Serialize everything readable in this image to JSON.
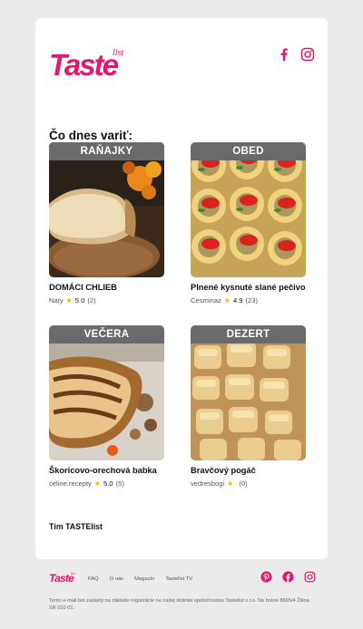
{
  "brand": {
    "logo_text": "Taste",
    "logo_suffix": "list",
    "accent_color": "#e2186f"
  },
  "header": {
    "social": [
      {
        "name": "facebook-icon"
      },
      {
        "name": "instagram-icon"
      }
    ]
  },
  "section": {
    "title": "Čo dnes variť:"
  },
  "recipes": [
    {
      "category": "RAŇAJKY",
      "title": "DOMÁCI CHLIEB",
      "author": "Naty",
      "rating": "5.0",
      "count": "(2)"
    },
    {
      "category": "OBED",
      "title": "Plnené kysnuté slané pečivo",
      "author": "Cesminaz",
      "rating": "4.9",
      "count": "(23)"
    },
    {
      "category": "VEČERA",
      "title": "Škoricovo-orechová babka",
      "author": "celine.recepty",
      "rating": "5.0",
      "count": "(5)"
    },
    {
      "category": "DEZERT",
      "title": "Bravčový pogáč",
      "author": "vedresbogi",
      "rating": "",
      "count": "(0)"
    }
  ],
  "signature": "Tím TASTElist",
  "footer": {
    "nav": [
      "FAQ",
      "O nás",
      "Magazín",
      "Tastelist TV"
    ],
    "social": [
      {
        "name": "pinterest-icon"
      },
      {
        "name": "facebook-icon"
      },
      {
        "name": "instagram-icon"
      }
    ],
    "legal": "Tento e-mail bol zaslaný na základe registrácie na našej stránke spoločnostou Tastelist s.r.o. Na bráne 8665/4 Žilina SR 010 01."
  }
}
